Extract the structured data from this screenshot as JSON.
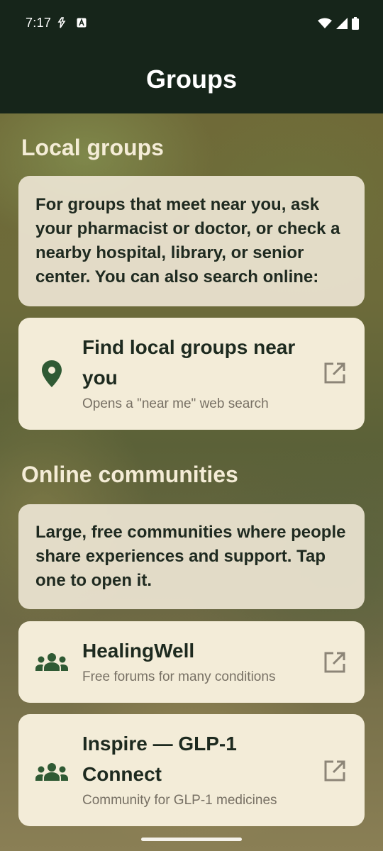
{
  "status_bar": {
    "time": "7:17"
  },
  "app_bar": {
    "title": "Groups"
  },
  "local_section": {
    "heading": "Local groups",
    "info": "For groups that meet near you, ask your pharmacist or doctor, or check a nearby hospital, library, or senior center. You can also search online:",
    "link": {
      "title": "Find local groups near you",
      "subtitle": "Opens a \"near me\" web search",
      "icon": "location-pin-icon"
    }
  },
  "online_section": {
    "heading": "Online communities",
    "info": "Large, free communities where people share experiences and support. Tap one to open it.",
    "links": [
      {
        "title": "HealingWell",
        "subtitle": "Free forums for many conditions",
        "icon": "groups-icon"
      },
      {
        "title": "Inspire — GLP-1 Connect",
        "subtitle": "Community for GLP-1 medicines",
        "icon": "groups-icon"
      }
    ]
  },
  "colors": {
    "app_bar": "#16251a",
    "accent_green": "#2f5a34",
    "card": "#f3ecd8"
  }
}
